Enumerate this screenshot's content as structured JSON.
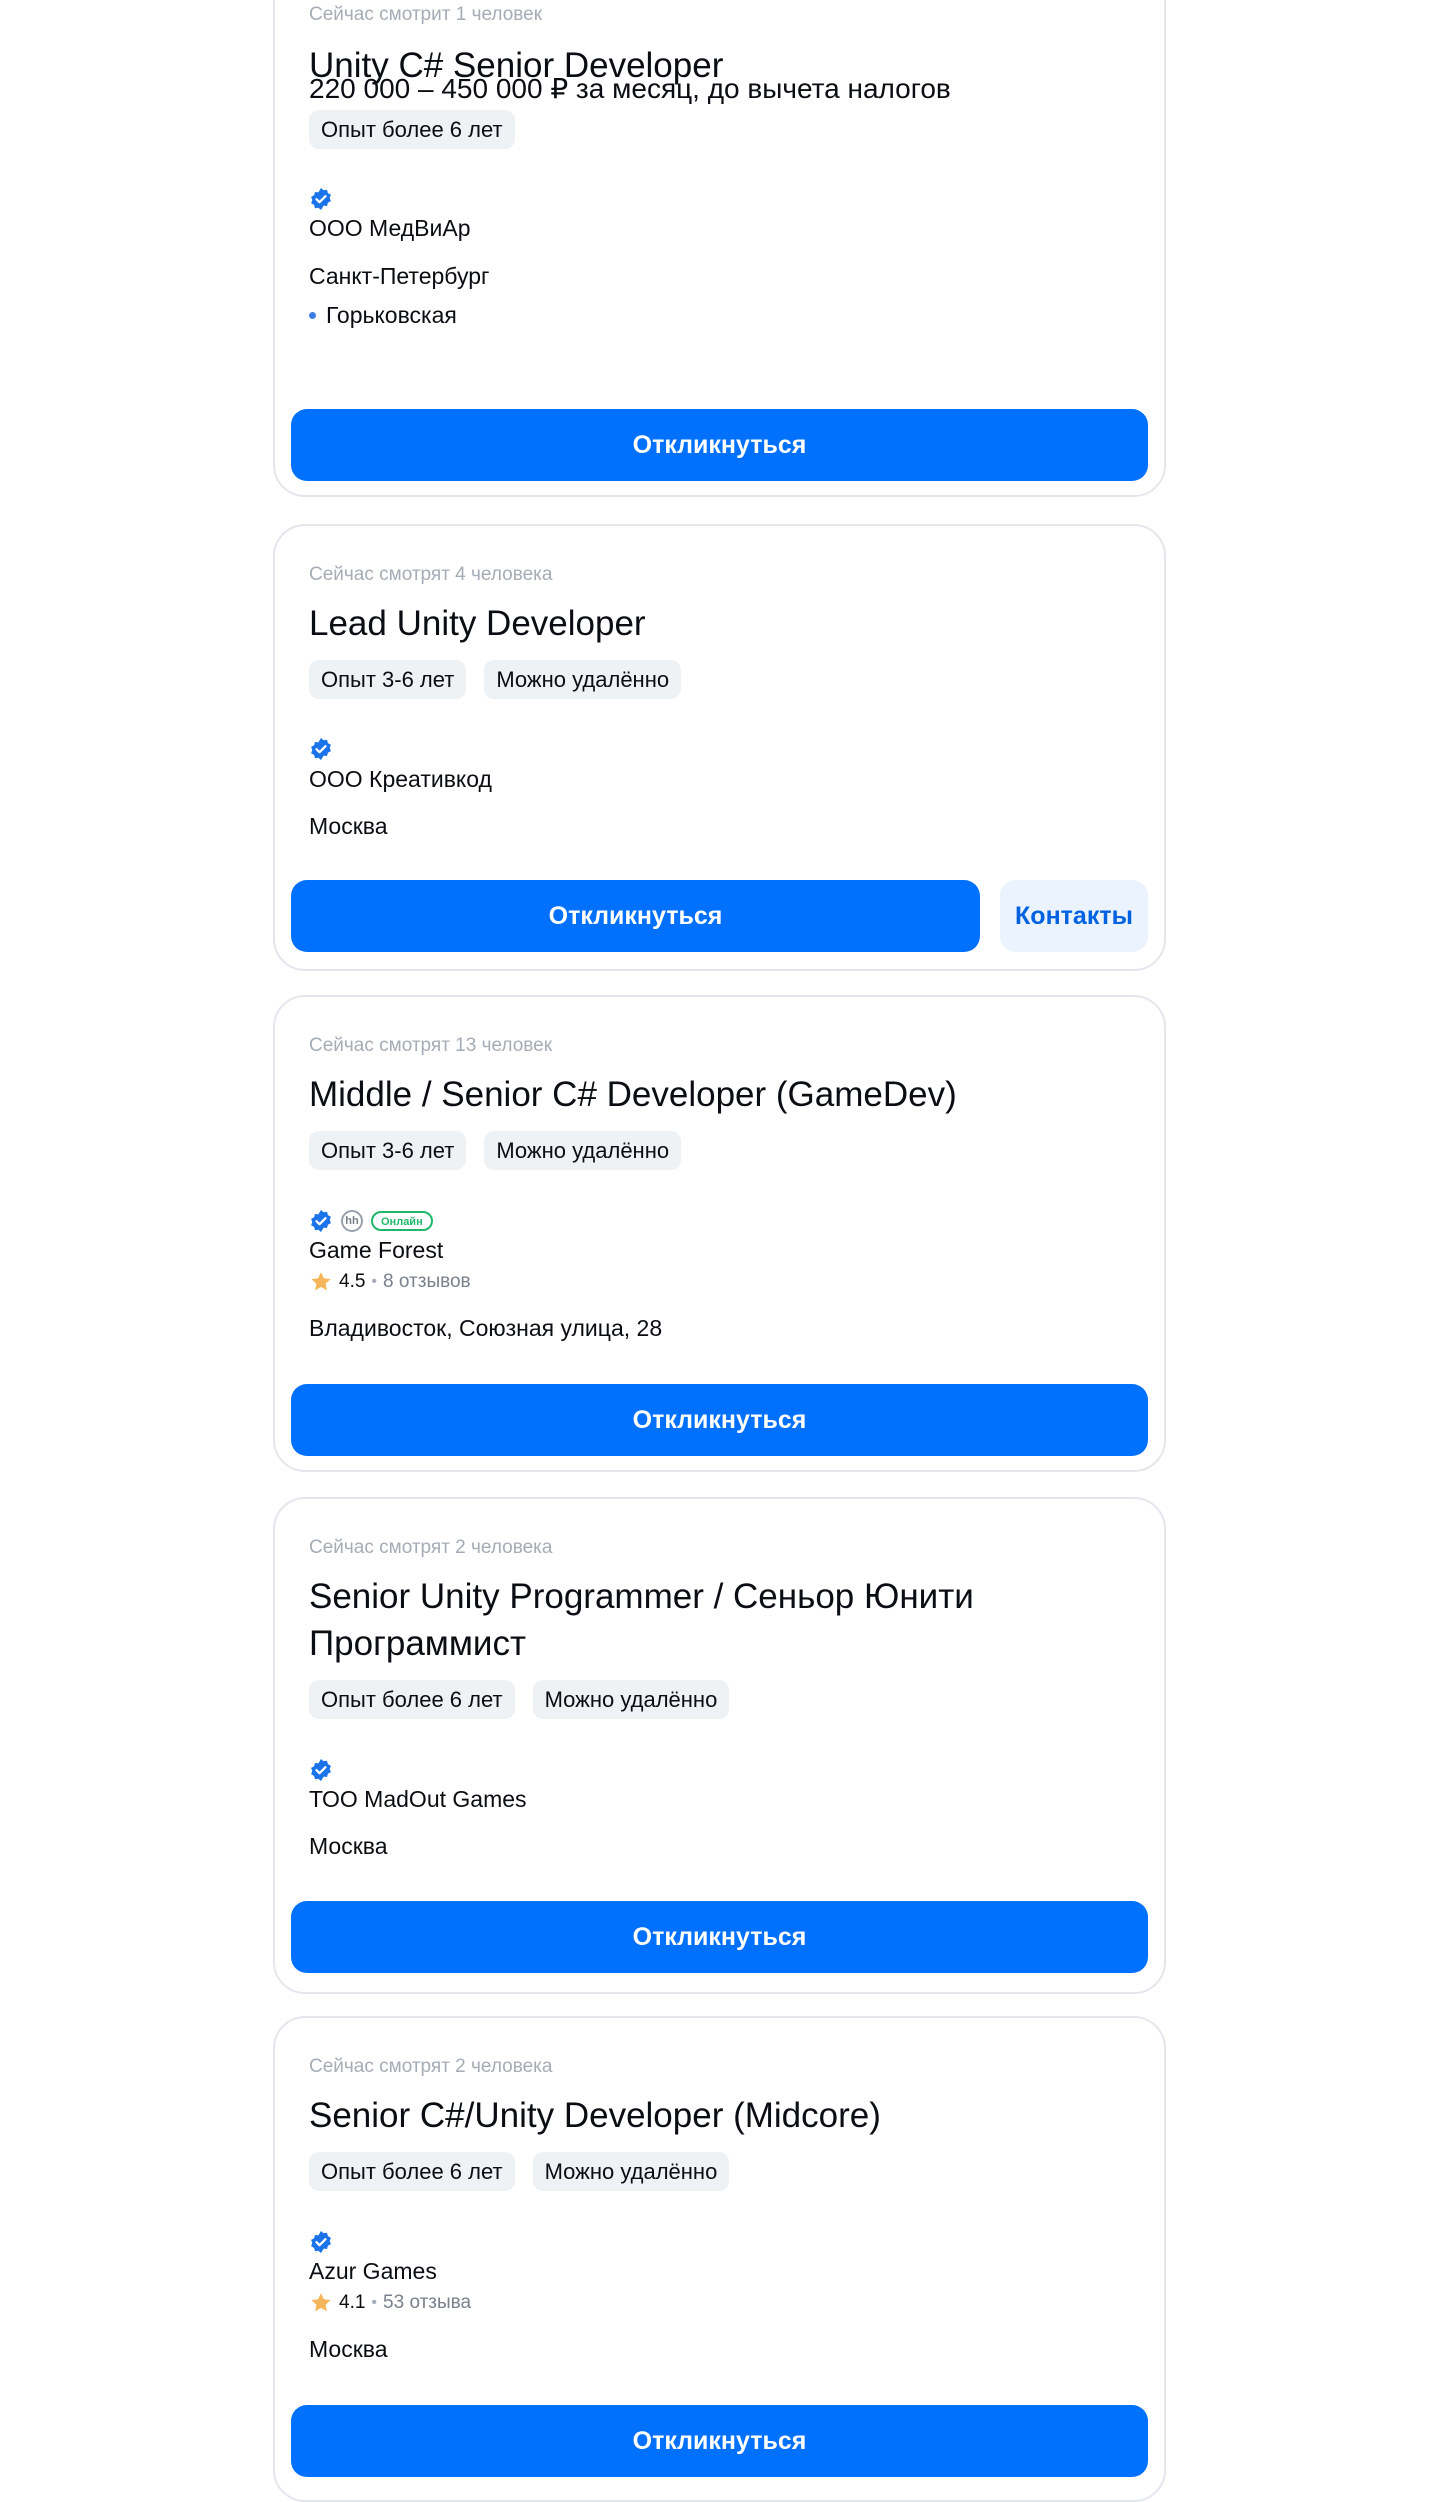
{
  "colors": {
    "accent": "#0070ff",
    "verified": "#1a73e8",
    "online": "#1fb86b",
    "star": "#f5b55b",
    "tag_bg": "#eff2f5",
    "secondary_bg": "#eaf3ff"
  },
  "vacancies": [
    {
      "viewers": "Сейчас смотрит 1 человек",
      "title": "Unity C# Senior Developer",
      "salary": "220 000 – 450 000 ₽ за месяц, до вычета налогов",
      "tags": [
        "Опыт более 6 лет"
      ],
      "verified_icon": "verified-check-icon",
      "company": "ООО МедВиАр",
      "city": "Санкт-Петербург",
      "metro": "Горьковская",
      "apply_label": "Откликнуться"
    },
    {
      "viewers": "Сейчас смотрят 4 человека",
      "title": "Lead Unity Developer",
      "tags": [
        "Опыт 3-6 лет",
        "Можно удалённо"
      ],
      "verified_icon": "verified-check-icon",
      "company": "ООО Креативкод",
      "city": "Москва",
      "apply_label": "Откликнуться",
      "contacts_label": "Контакты"
    },
    {
      "viewers": "Сейчас смотрят 13 человек",
      "title": "Middle / Senior C# Developer (GameDev)",
      "tags": [
        "Опыт 3-6 лет",
        "Можно удалённо"
      ],
      "verified_icon": "verified-check-icon",
      "hh_icon": "hh",
      "online_badge": "Онлайн",
      "company": "Game Forest",
      "rating": "4.5",
      "reviews": "8 отзывов",
      "city": "Владивосток, Союзная улица, 28",
      "apply_label": "Откликнуться"
    },
    {
      "viewers": "Сейчас смотрят 2 человека",
      "title": "Senior Unity Programmer / Сеньор Юнити Программист",
      "tags": [
        "Опыт более 6 лет",
        "Можно удалённо"
      ],
      "verified_icon": "verified-check-icon",
      "company": "ТОО MadOut Games",
      "city": "Москва",
      "apply_label": "Откликнуться"
    },
    {
      "viewers": "Сейчас смотрят 2 человека",
      "title": "Senior C#/Unity Developer (Midcore)",
      "tags": [
        "Опыт более 6 лет",
        "Можно удалённо"
      ],
      "verified_icon": "verified-check-icon",
      "company": "Azur Games",
      "rating": "4.1",
      "reviews": "53 отзыва",
      "city": "Москва",
      "apply_label": "Откликнуться"
    }
  ]
}
